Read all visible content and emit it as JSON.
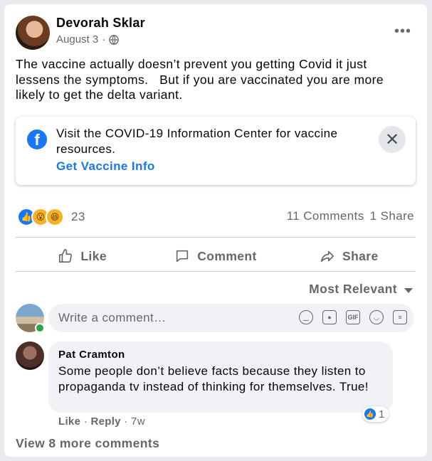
{
  "post": {
    "author": "Devorah Sklar",
    "date": "August 3",
    "separator": "·",
    "privacy_icon": "globe-icon",
    "more_icon": "more-dots-icon",
    "text": "The vaccine actually doesn’t prevent you getting Covid it just lessens the symptoms.   But if you are vaccinated you are more likely to get the delta variant."
  },
  "info_box": {
    "icon": "facebook-logo-icon",
    "text": "Visit the COVID-19 Information Center for vaccine resources.",
    "link": "Get Vaccine Info",
    "close_icon": "close-icon"
  },
  "reactions": {
    "types": [
      "like",
      "wow",
      "haha"
    ],
    "count": "23",
    "comments": "11 Comments",
    "shares": "1 Share"
  },
  "actions": {
    "like": "Like",
    "comment": "Comment",
    "share": "Share"
  },
  "sort": {
    "label": "Most Relevant"
  },
  "composer": {
    "placeholder": "Write a comment…",
    "icons": [
      "emoji-icon",
      "camera-icon",
      "gif-icon",
      "sticker-icon",
      "avatar-sticker-icon"
    ]
  },
  "comment": {
    "author": "Pat Cramton",
    "text": "Some people don’t believe facts because they listen to propaganda tv instead of thinking for themselves. True!",
    "like": "Like",
    "reply": "Reply",
    "time": "7w",
    "reaction_count": "1"
  },
  "view_more": "View 8 more comments",
  "colors": {
    "accent": "#1877f2",
    "muted": "#65676b",
    "bubble": "#f0f2f5"
  }
}
